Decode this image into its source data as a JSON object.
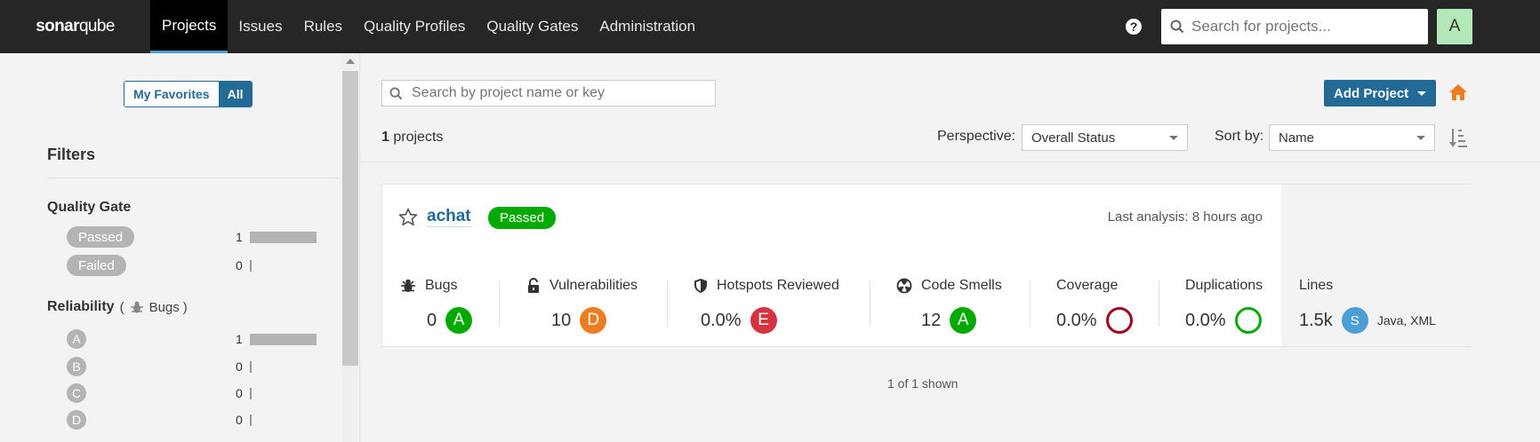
{
  "nav": {
    "logo_bold": "sonar",
    "logo_thin": "qube",
    "items": [
      "Projects",
      "Issues",
      "Rules",
      "Quality Profiles",
      "Quality Gates",
      "Administration"
    ],
    "active": "Projects",
    "help_glyph": "?",
    "search_placeholder": "Search for projects...",
    "avatar_letter": "A"
  },
  "sidebar": {
    "toggle_favorites": "My Favorites",
    "toggle_all": "All",
    "filters_title": "Filters",
    "quality_gate": {
      "title": "Quality Gate",
      "options": [
        {
          "label": "Passed",
          "count": "1"
        },
        {
          "label": "Failed",
          "count": "0"
        }
      ]
    },
    "reliability": {
      "title": "Reliability",
      "open_paren": "(",
      "sub": "Bugs",
      "close_paren": ")",
      "options": [
        {
          "label": "A",
          "count": "1"
        },
        {
          "label": "B",
          "count": "0"
        },
        {
          "label": "C",
          "count": "0"
        },
        {
          "label": "D",
          "count": "0"
        }
      ]
    }
  },
  "main": {
    "search_placeholder": "Search by project name or key",
    "add_project_label": "Add Project",
    "projects_count": "1",
    "projects_word": "projects",
    "perspective_label": "Perspective:",
    "perspective_value": "Overall Status",
    "sort_label": "Sort by:",
    "sort_value": "Name",
    "shown_text": "1 of 1 shown"
  },
  "project": {
    "name": "achat",
    "gate_status": "Passed",
    "last_analysis": "Last analysis: 8 hours ago",
    "measures": {
      "bugs": {
        "label": "Bugs",
        "value": "0",
        "rating": "A"
      },
      "vulnerabilities": {
        "label": "Vulnerabilities",
        "value": "10",
        "rating": "D"
      },
      "hotspots": {
        "label": "Hotspots Reviewed",
        "value": "0.0%",
        "rating": "E"
      },
      "code_smells": {
        "label": "Code Smells",
        "value": "12",
        "rating": "A"
      },
      "coverage": {
        "label": "Coverage",
        "value": "0.0%"
      },
      "duplications": {
        "label": "Duplications",
        "value": "0.0%"
      },
      "lines": {
        "label": "Lines",
        "value": "1.5k",
        "size": "S",
        "languages": "Java, XML"
      }
    }
  },
  "colors": {
    "navbar": "#262626",
    "brand_blue": "#236a97",
    "rating_a": "#00aa00",
    "rating_d": "#ed7d20",
    "rating_e": "#d4333f",
    "coverage_ring": "#a0001a",
    "duplication_ring": "#00aa00",
    "size_badge": "#4b9fd5",
    "home_icon": "#ed7d20"
  },
  "icons": [
    "search-icon",
    "help-icon",
    "home-icon",
    "sort-icon",
    "star-icon",
    "bug-icon",
    "lock-icon",
    "shield-icon",
    "code-smell-icon"
  ]
}
